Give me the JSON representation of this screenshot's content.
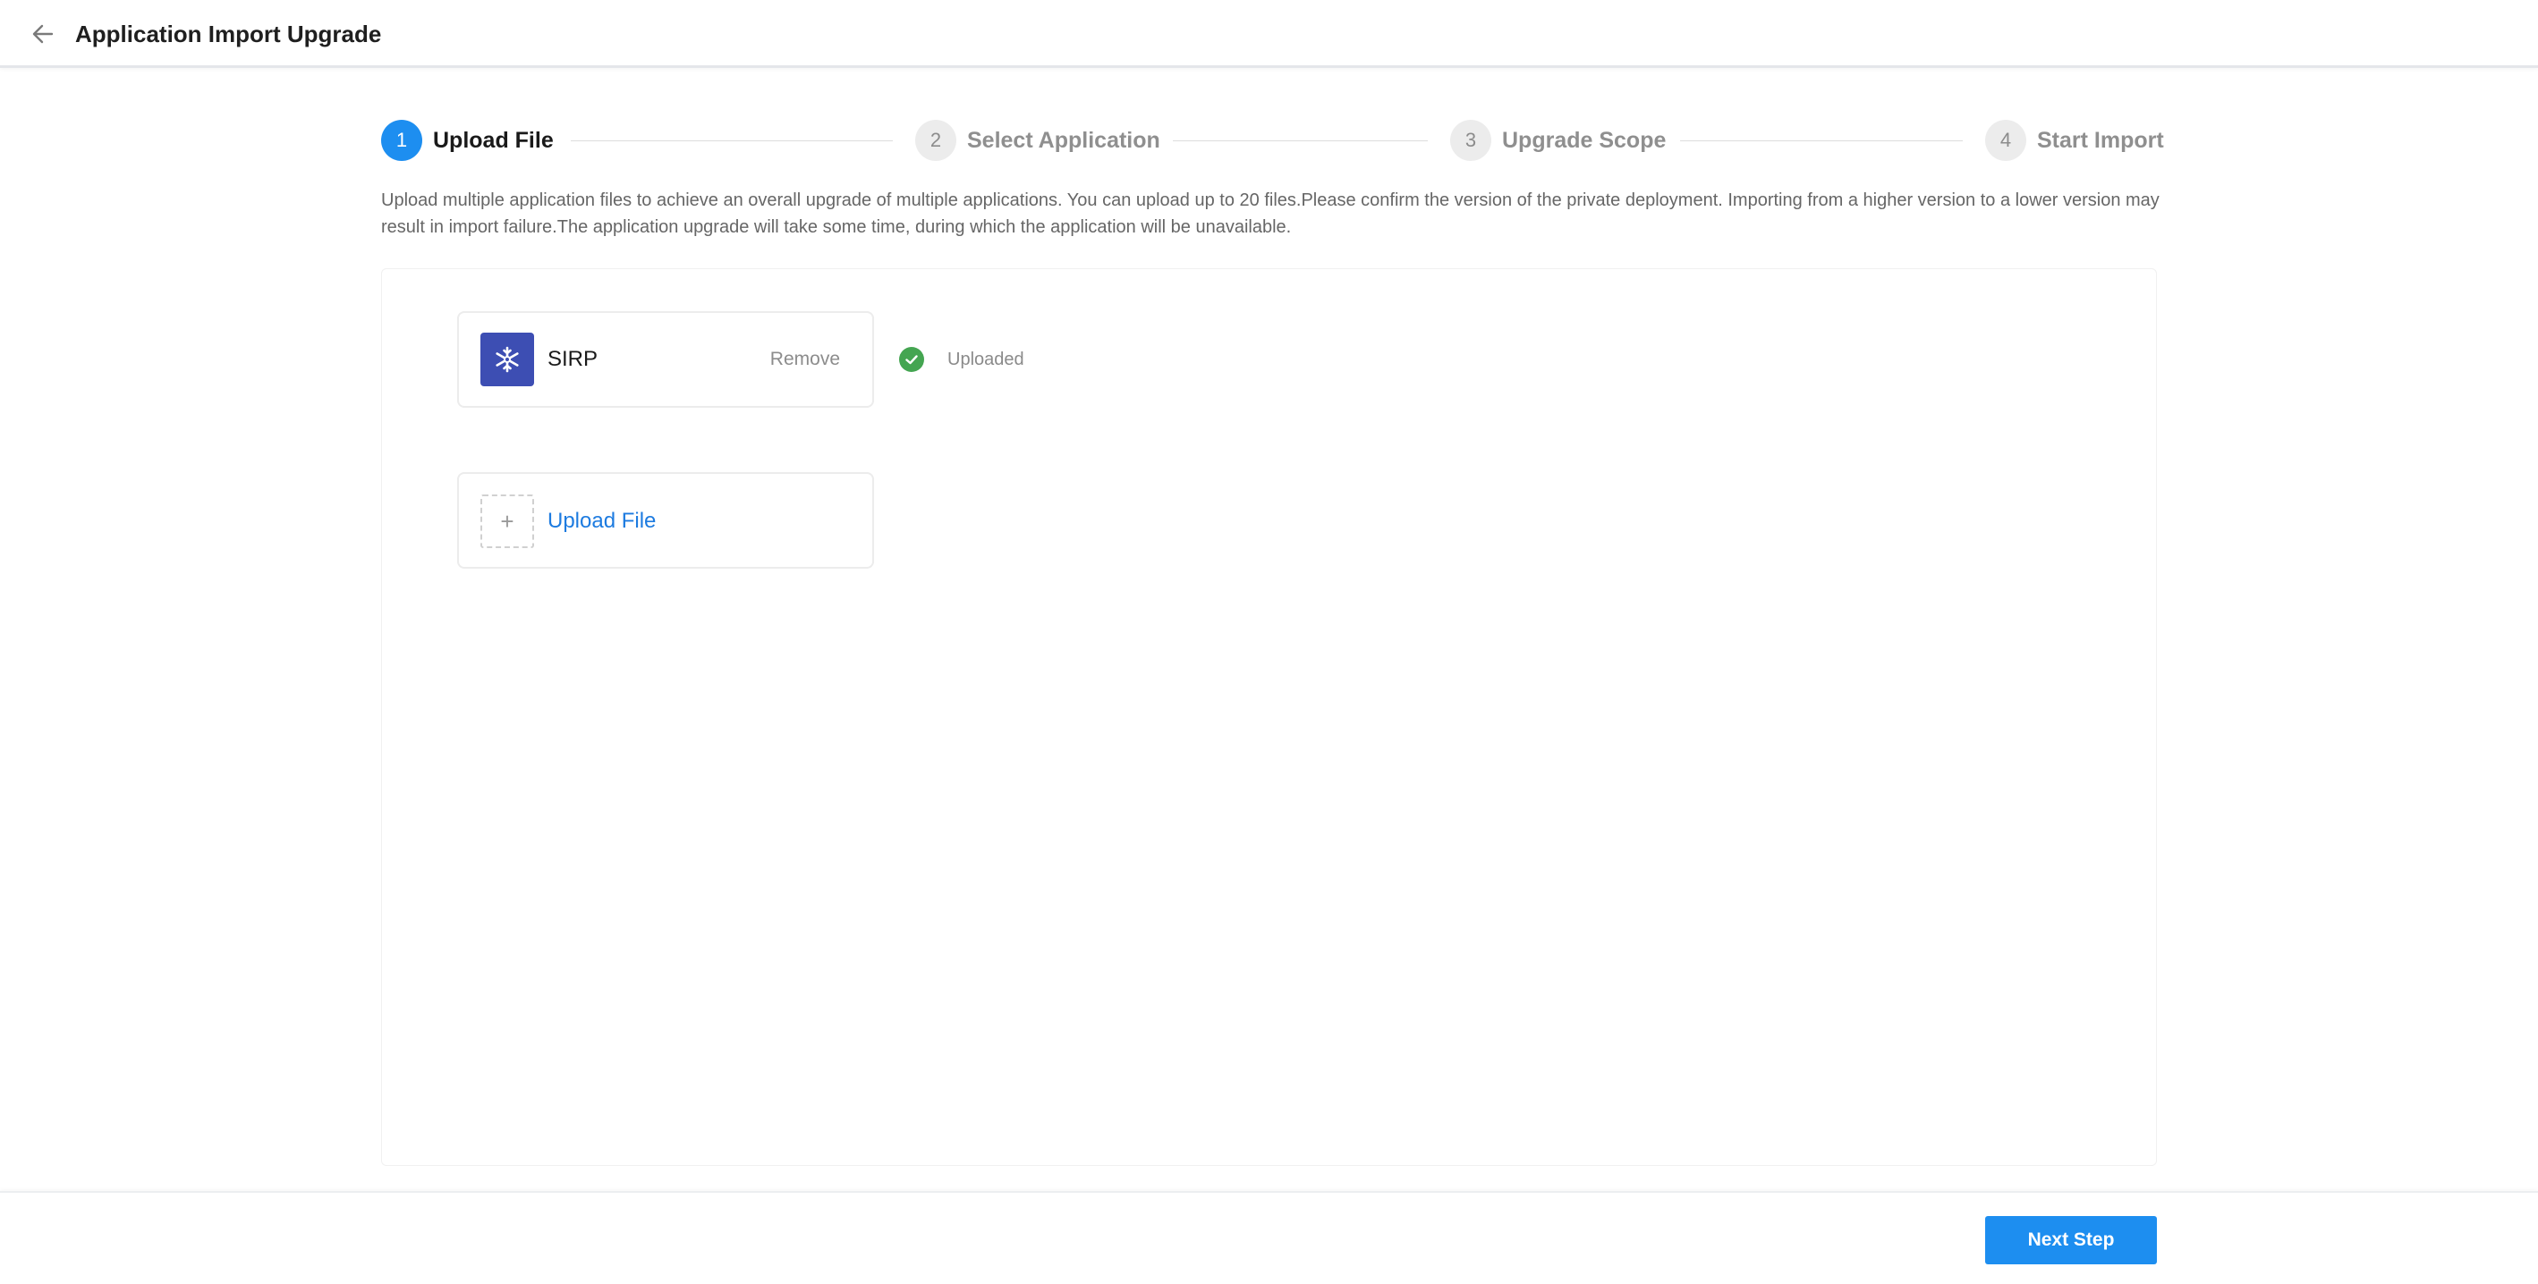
{
  "header": {
    "title": "Application Import Upgrade",
    "back_icon": "arrow-left-icon"
  },
  "steps": [
    {
      "number": "1",
      "label": "Upload File",
      "state": "active"
    },
    {
      "number": "2",
      "label": "Select Application",
      "state": "inactive"
    },
    {
      "number": "3",
      "label": "Upgrade Scope",
      "state": "inactive"
    },
    {
      "number": "4",
      "label": "Start Import",
      "state": "inactive"
    }
  ],
  "description": "Upload multiple application files to achieve an overall upgrade of multiple applications. You can upload up to 20 files.Please confirm the version of the private deployment. Importing from a higher version to a lower version may result in import failure.The application upgrade will take some time, during which the application will be unavailable.",
  "files": [
    {
      "name": "SIRP",
      "icon": "snowflake-icon",
      "remove_label": "Remove",
      "status": "Uploaded",
      "status_icon": "check-circle-icon"
    }
  ],
  "upload": {
    "label": "Upload File",
    "icon": "plus-icon",
    "plus_glyph": "+"
  },
  "footer": {
    "next_label": "Next Step"
  },
  "colors": {
    "accent": "#1d8ef0",
    "app_icon_bg": "#3d4eb3",
    "success": "#44a551",
    "link": "#1d7be0"
  }
}
